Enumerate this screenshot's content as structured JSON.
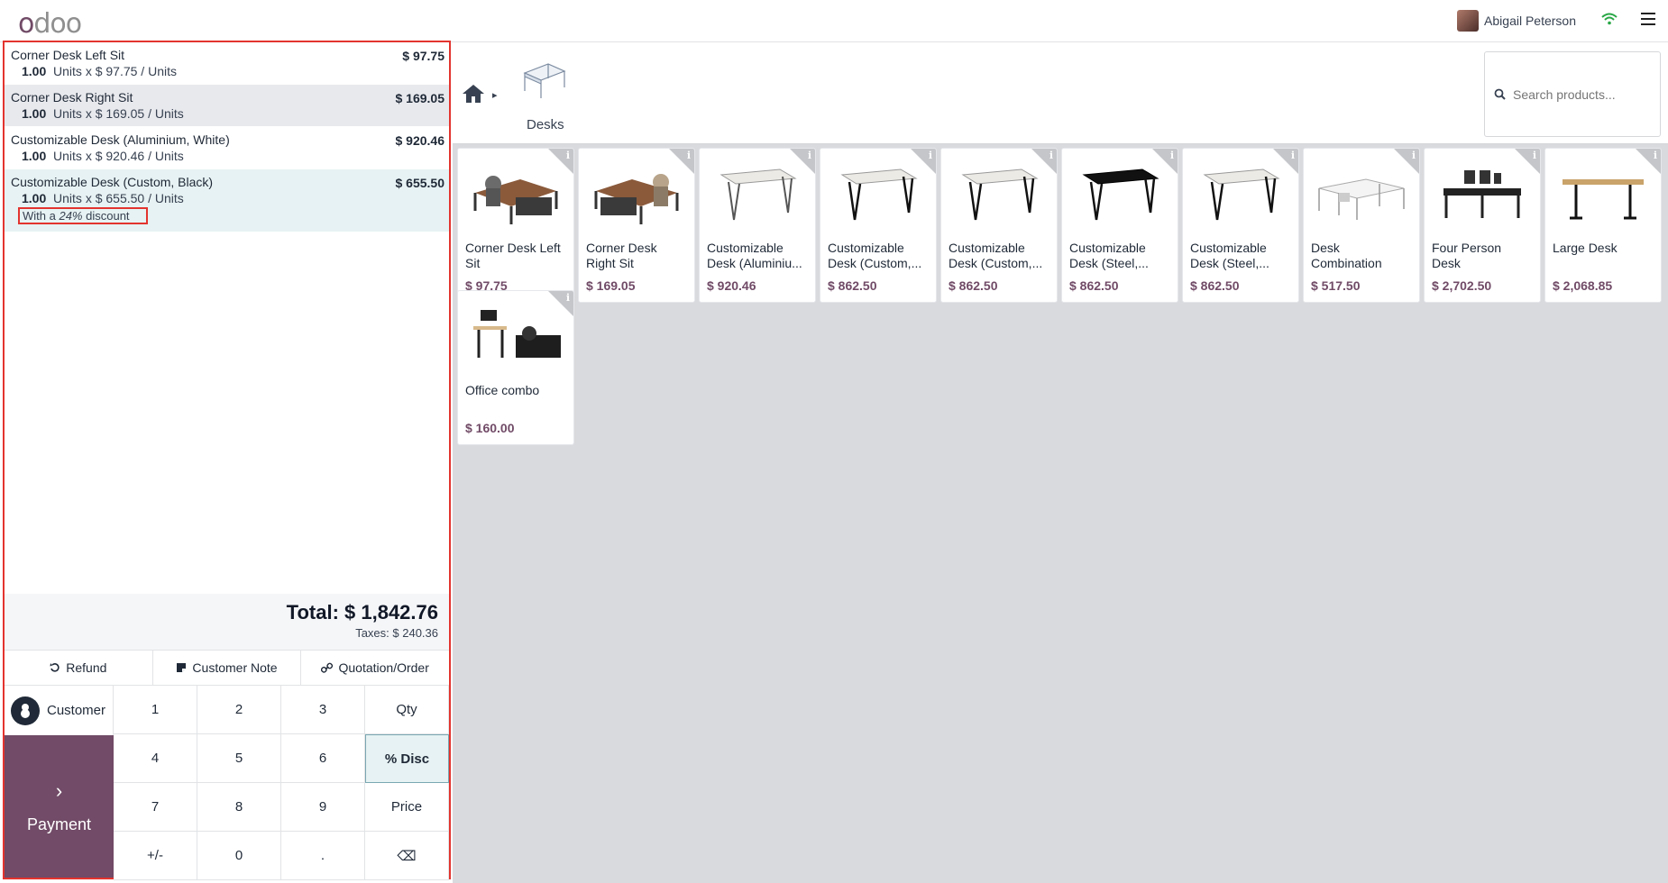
{
  "app": {
    "logo": "odoo"
  },
  "topbar": {
    "user_name": "Abigail Peterson"
  },
  "order": {
    "lines": [
      {
        "name": "Corner Desk Left Sit",
        "price": "$ 97.75",
        "qty": "1.00",
        "detail": "Units x $ 97.75 / Units"
      },
      {
        "name": "Corner Desk Right Sit",
        "price": "$ 169.05",
        "qty": "1.00",
        "detail": "Units x $ 169.05 / Units"
      },
      {
        "name": "Customizable Desk (Aluminium, White)",
        "price": "$ 920.46",
        "qty": "1.00",
        "detail": "Units x $ 920.46 / Units"
      },
      {
        "name": "Customizable Desk (Custom, Black)",
        "price": "$ 655.50",
        "qty": "1.00",
        "detail": "Units x $ 655.50 / Units",
        "discount_prefix": "With a ",
        "discount_value": "24%",
        "discount_suffix": " discount"
      }
    ],
    "total": "Total: $ 1,842.76",
    "taxes": "Taxes: $ 240.36"
  },
  "actions": {
    "refund": "Refund",
    "customer_note": "Customer Note",
    "quotation": "Quotation/Order"
  },
  "pad": {
    "customer": "Customer",
    "payment": "Payment",
    "keys": [
      "1",
      "2",
      "3",
      "Qty",
      "4",
      "5",
      "6",
      "% Disc",
      "7",
      "8",
      "9",
      "Price",
      "+/-",
      "0",
      ".",
      "⌫"
    ]
  },
  "category": {
    "label": "Desks"
  },
  "search": {
    "placeholder": "Search products..."
  },
  "products": [
    {
      "name": "Corner Desk Left Sit",
      "price": "$ 97.75",
      "img": "corner-left"
    },
    {
      "name": "Corner Desk Right Sit",
      "price": "$ 169.05",
      "img": "corner-right"
    },
    {
      "name": "Customizable Desk (Aluminiu...",
      "price": "$ 920.46",
      "img": "table-white"
    },
    {
      "name": "Customizable Desk (Custom,...",
      "price": "$ 862.50",
      "img": "table-white-black"
    },
    {
      "name": "Customizable Desk (Custom,...",
      "price": "$ 862.50",
      "img": "table-white-black"
    },
    {
      "name": "Customizable Desk (Steel,...",
      "price": "$ 862.50",
      "img": "table-black"
    },
    {
      "name": "Customizable Desk (Steel,...",
      "price": "$ 862.50",
      "img": "table-white-black"
    },
    {
      "name": "Desk Combination",
      "price": "$ 517.50",
      "img": "desk-combination"
    },
    {
      "name": "Four Person Desk",
      "price": "$ 2,702.50",
      "img": "four-person"
    },
    {
      "name": "Large Desk",
      "price": "$ 2,068.85",
      "img": "large-desk"
    },
    {
      "name": "Office combo",
      "price": "$ 160.00",
      "img": "office-combo"
    }
  ],
  "colors": {
    "brand": "#714b67",
    "selection": "#e6f2f3",
    "highlight_border": "#e3342f"
  }
}
